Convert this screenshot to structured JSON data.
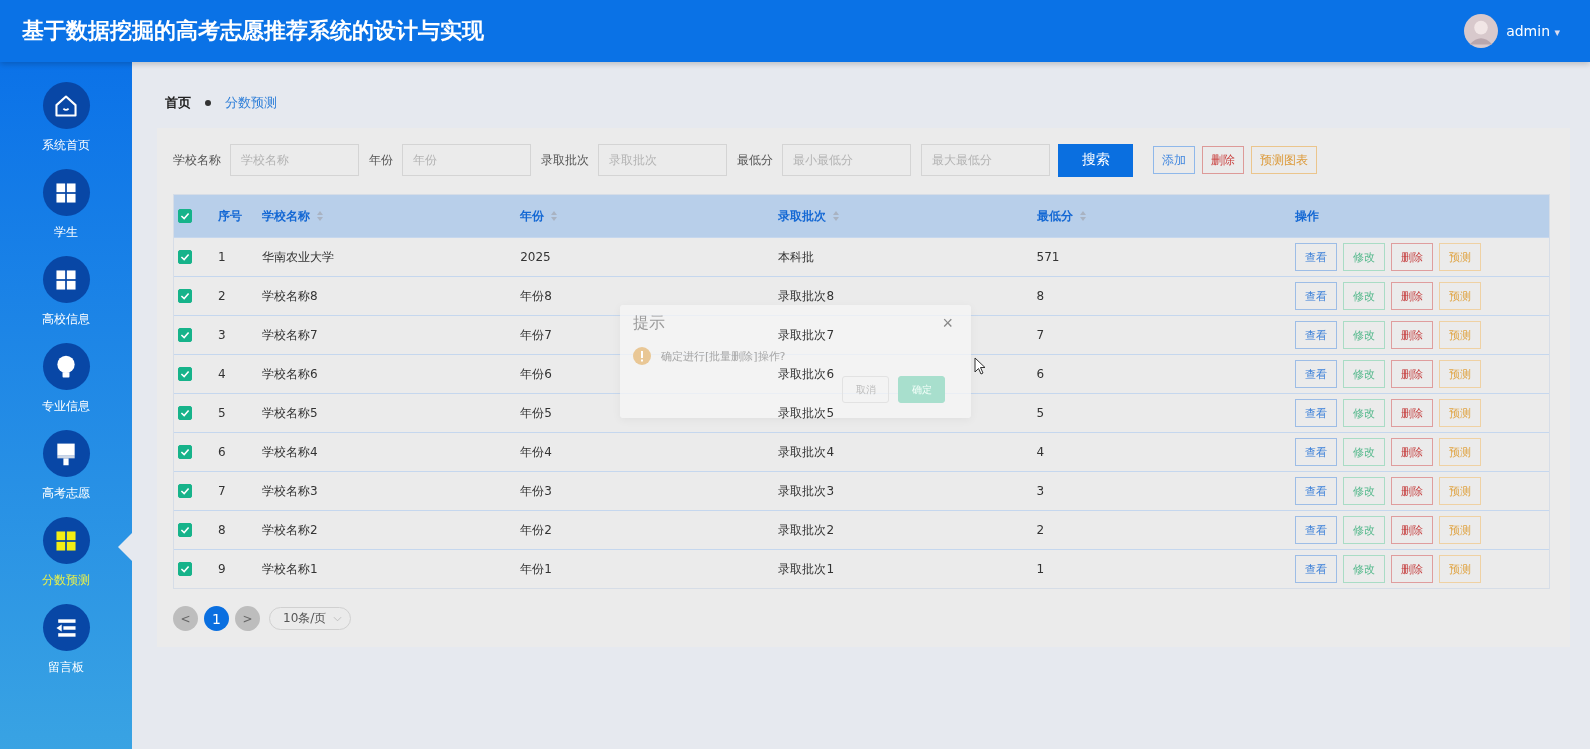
{
  "header": {
    "title": "基于数据挖掘的高考志愿推荐系统的设计与实现",
    "user": {
      "name": "admin",
      "caret": "▾"
    }
  },
  "sidebar": {
    "items": [
      {
        "label": "系统首页",
        "selected": false
      },
      {
        "label": "学生",
        "selected": false
      },
      {
        "label": "高校信息",
        "selected": false
      },
      {
        "label": "专业信息",
        "selected": false
      },
      {
        "label": "高考志愿",
        "selected": false
      },
      {
        "label": "分数预测",
        "selected": true
      },
      {
        "label": "留言板",
        "selected": false
      }
    ]
  },
  "breadcrumb": [
    {
      "label": "首页",
      "selected": false
    },
    {
      "label": "分数预测",
      "selected": true
    }
  ],
  "search": {
    "fields": [
      {
        "label": "学校名称",
        "placeholder": "学校名称"
      },
      {
        "label": "年份",
        "placeholder": "年份"
      },
      {
        "label": "录取批次",
        "placeholder": "录取批次"
      },
      {
        "label": "最低分",
        "placeholder": "最小最低分"
      },
      {
        "placeholder": "最大最低分"
      }
    ],
    "buttons": [
      {
        "label": "搜索",
        "kind": "primary"
      },
      {
        "label": "添加",
        "kind": "add"
      },
      {
        "label": "删除",
        "kind": "delete"
      },
      {
        "label": "预测图表",
        "kind": "chart"
      }
    ]
  },
  "table": {
    "all_checked": true,
    "columns": [
      {
        "label": "序号",
        "sortable": false
      },
      {
        "label": "学校名称",
        "sortable": true
      },
      {
        "label": "年份",
        "sortable": true
      },
      {
        "label": "录取批次",
        "sortable": true
      },
      {
        "label": "最低分",
        "sortable": true
      },
      {
        "label": "操作",
        "sortable": false
      }
    ],
    "rows": [
      {
        "checked": true,
        "cells": [
          "1",
          "华南农业大学",
          "2025",
          "本科批",
          "571"
        ],
        "actions": [
          {
            "label": "查看",
            "kind": "view"
          },
          {
            "label": "修改",
            "kind": "edit"
          },
          {
            "label": "删除",
            "kind": "delete"
          },
          {
            "label": "预测",
            "kind": "predict"
          }
        ]
      },
      {
        "checked": true,
        "cells": [
          "2",
          "学校名称8",
          "年份8",
          "录取批次8",
          "8"
        ],
        "actions": [
          {
            "label": "查看",
            "kind": "view"
          },
          {
            "label": "修改",
            "kind": "edit"
          },
          {
            "label": "删除",
            "kind": "delete"
          },
          {
            "label": "预测",
            "kind": "predict"
          }
        ]
      },
      {
        "checked": true,
        "cells": [
          "3",
          "学校名称7",
          "年份7",
          "录取批次7",
          "7"
        ],
        "actions": [
          {
            "label": "查看",
            "kind": "view"
          },
          {
            "label": "修改",
            "kind": "edit"
          },
          {
            "label": "删除",
            "kind": "delete"
          },
          {
            "label": "预测",
            "kind": "predict"
          }
        ]
      },
      {
        "checked": true,
        "cells": [
          "4",
          "学校名称6",
          "年份6",
          "录取批次6",
          "6"
        ],
        "actions": [
          {
            "label": "查看",
            "kind": "view"
          },
          {
            "label": "修改",
            "kind": "edit"
          },
          {
            "label": "删除",
            "kind": "delete"
          },
          {
            "label": "预测",
            "kind": "predict"
          }
        ]
      },
      {
        "checked": true,
        "cells": [
          "5",
          "学校名称5",
          "年份5",
          "录取批次5",
          "5"
        ],
        "actions": [
          {
            "label": "查看",
            "kind": "view"
          },
          {
            "label": "修改",
            "kind": "edit"
          },
          {
            "label": "删除",
            "kind": "delete"
          },
          {
            "label": "预测",
            "kind": "predict"
          }
        ]
      },
      {
        "checked": true,
        "cells": [
          "6",
          "学校名称4",
          "年份4",
          "录取批次4",
          "4"
        ],
        "actions": [
          {
            "label": "查看",
            "kind": "view"
          },
          {
            "label": "修改",
            "kind": "edit"
          },
          {
            "label": "删除",
            "kind": "delete"
          },
          {
            "label": "预测",
            "kind": "predict"
          }
        ]
      },
      {
        "checked": true,
        "cells": [
          "7",
          "学校名称3",
          "年份3",
          "录取批次3",
          "3"
        ],
        "actions": [
          {
            "label": "查看",
            "kind": "view"
          },
          {
            "label": "修改",
            "kind": "edit"
          },
          {
            "label": "删除",
            "kind": "delete"
          },
          {
            "label": "预测",
            "kind": "predict"
          }
        ]
      },
      {
        "checked": true,
        "cells": [
          "8",
          "学校名称2",
          "年份2",
          "录取批次2",
          "2"
        ],
        "actions": [
          {
            "label": "查看",
            "kind": "view"
          },
          {
            "label": "修改",
            "kind": "edit"
          },
          {
            "label": "删除",
            "kind": "delete"
          },
          {
            "label": "预测",
            "kind": "predict"
          }
        ]
      },
      {
        "checked": true,
        "cells": [
          "9",
          "学校名称1",
          "年份1",
          "录取批次1",
          "1"
        ],
        "actions": [
          {
            "label": "查看",
            "kind": "view"
          },
          {
            "label": "修改",
            "kind": "edit"
          },
          {
            "label": "删除",
            "kind": "delete"
          },
          {
            "label": "预测",
            "kind": "predict"
          }
        ]
      }
    ]
  },
  "pagination": {
    "prev": "<",
    "next": ">",
    "pages": [
      {
        "label": "1",
        "selected": true
      }
    ],
    "page_size": "10条/页"
  },
  "dialog": {
    "title": "提示",
    "close": "×",
    "message": "确定进行[批量删除]操作?",
    "buttons": [
      {
        "label": "取消",
        "kind": "cancel"
      },
      {
        "label": "确定",
        "kind": "confirm"
      }
    ]
  }
}
